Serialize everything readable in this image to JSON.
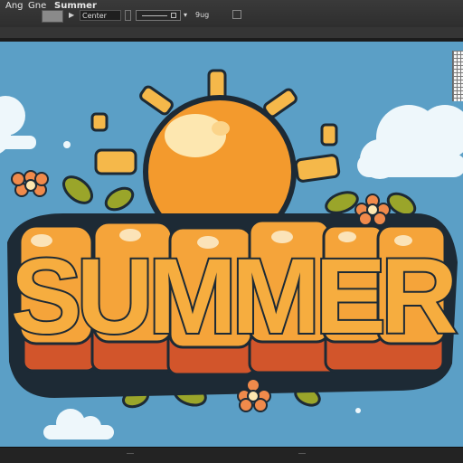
{
  "menu": {
    "item_1": "Ang",
    "item_2": "Gne",
    "item_3": "Summer"
  },
  "options_bar": {
    "mode_field": "Center",
    "unit_label": "9ug"
  },
  "artwork": {
    "title_text": "SUMMER"
  },
  "colors": {
    "sky": "#5b9fc6",
    "sun": "#f39a2d",
    "letter_face": "#f5a43a",
    "letter_side": "#d2552b",
    "outline": "#1d2a35",
    "leaf": "#9aa52a",
    "flower": "#f08a4b",
    "cloud": "#eef7fb"
  },
  "icons": [
    "play-icon",
    "stepper-icon",
    "dropdown-icon",
    "checkbox-icon"
  ]
}
